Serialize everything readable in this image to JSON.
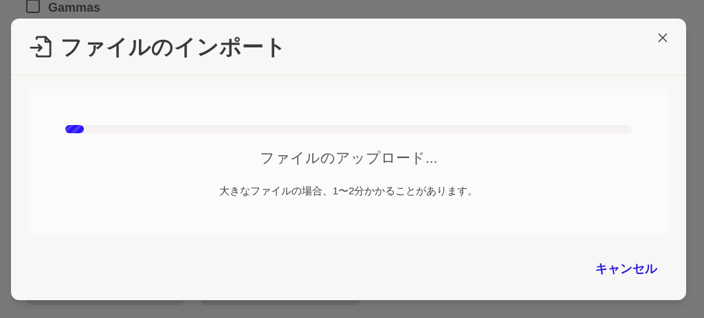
{
  "background": {
    "list_item": {
      "label": "Gammas",
      "checked": false
    }
  },
  "dialog": {
    "title": "ファイルのインポート",
    "progress": {
      "level": 0.033,
      "status": "ファイルのアップロード...",
      "note": "大きなファイルの場合、1〜2分かかることがあります。"
    },
    "buttons": [
      {
        "label": "キャンセル",
        "kind": "link"
      }
    ]
  }
}
